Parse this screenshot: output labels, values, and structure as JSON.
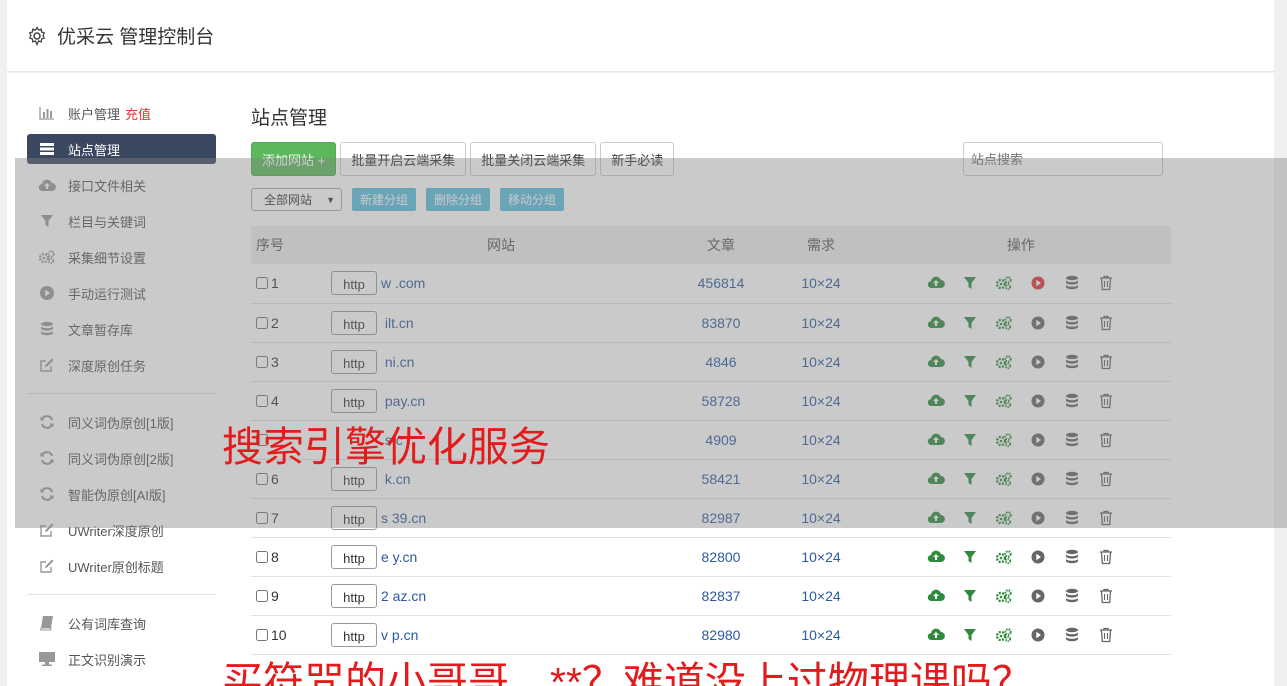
{
  "header": {
    "title": "优采云 管理控制台"
  },
  "sidebar": {
    "items": [
      {
        "label": "账户管理",
        "extra": "充值",
        "icon": "bar-chart-icon"
      },
      {
        "label": "站点管理",
        "icon": "server-list-icon",
        "active": true
      },
      {
        "label": "接口文件相关",
        "icon": "cloud-upload-icon"
      },
      {
        "label": "栏目与关键词",
        "icon": "filter-icon"
      },
      {
        "label": "采集细节设置",
        "icon": "gears-icon"
      },
      {
        "label": "手动运行测试",
        "icon": "play-circle-icon"
      },
      {
        "label": "文章暂存库",
        "icon": "database-icon"
      },
      {
        "label": "深度原创任务",
        "icon": "edit-icon"
      }
    ],
    "items2": [
      {
        "label": "同义词伪原创[1版]",
        "icon": "refresh-icon"
      },
      {
        "label": "同义词伪原创[2版]",
        "icon": "refresh-icon"
      },
      {
        "label": "智能伪原创[AI版]",
        "icon": "refresh-icon"
      },
      {
        "label": "UWriter深度原创",
        "icon": "edit-icon"
      },
      {
        "label": "UWriter原创标题",
        "icon": "edit-icon"
      }
    ],
    "items3": [
      {
        "label": "公有词库查询",
        "icon": "book-icon"
      },
      {
        "label": "正文识别演示",
        "icon": "monitor-icon"
      }
    ]
  },
  "main": {
    "title": "站点管理",
    "toolbar": {
      "add_site": "添加网站 +",
      "batch_open": "批量开启云端采集",
      "batch_close": "批量关闭云端采集",
      "guide": "新手必读"
    },
    "search": {
      "placeholder": "站点搜索"
    },
    "filter": {
      "group_select": "全部网站",
      "new_group": "新建分组",
      "delete_group": "删除分组",
      "move_group": "移动分组"
    },
    "table": {
      "headers": {
        "no": "序号",
        "site": "网站",
        "articles": "文章",
        "demand": "需求",
        "ops": "操作"
      },
      "rows": [
        {
          "no": "1",
          "proto": "http",
          "domain": "w        .com",
          "articles": "456814",
          "demand": "10×24",
          "running": true
        },
        {
          "no": "2",
          "proto": "http",
          "domain": "    ilt.cn",
          "articles": "83870",
          "demand": "10×24",
          "running": false
        },
        {
          "no": "3",
          "proto": "http",
          "domain": "     ni.cn",
          "articles": "4846",
          "demand": "10×24",
          "running": false
        },
        {
          "no": "4",
          "proto": "http",
          "domain": "      pay.cn",
          "articles": "58728",
          "demand": "10×24",
          "running": false
        },
        {
          "no": "",
          "proto": "",
          "domain": "    s.c",
          "articles": "4909",
          "demand": "10×24",
          "running": false
        },
        {
          "no": "6",
          "proto": "http",
          "domain": "     k.cn",
          "articles": "58421",
          "demand": "10×24",
          "running": false
        },
        {
          "no": "7",
          "proto": "http",
          "domain": "s  39.cn",
          "articles": "82987",
          "demand": "10×24",
          "running": false
        },
        {
          "no": "8",
          "proto": "http",
          "domain": "e    y.cn",
          "articles": "82800",
          "demand": "10×24",
          "running": false
        },
        {
          "no": "9",
          "proto": "http",
          "domain": "2    az.cn",
          "articles": "82837",
          "demand": "10×24",
          "running": false
        },
        {
          "no": "10",
          "proto": "http",
          "domain": "v    p.cn",
          "articles": "82980",
          "demand": "10×24",
          "running": false
        }
      ]
    }
  },
  "watermarks": {
    "line1": "搜索引擎优化服务",
    "line2": "买符咒的小哥哥，**？难道没上过物理课吗？"
  },
  "colors": {
    "sidebar_active": "#3a4760",
    "green": "#5cb85c",
    "link": "#2a5aa0",
    "accent_red": "#e33",
    "watermark": "#e21c1c"
  }
}
